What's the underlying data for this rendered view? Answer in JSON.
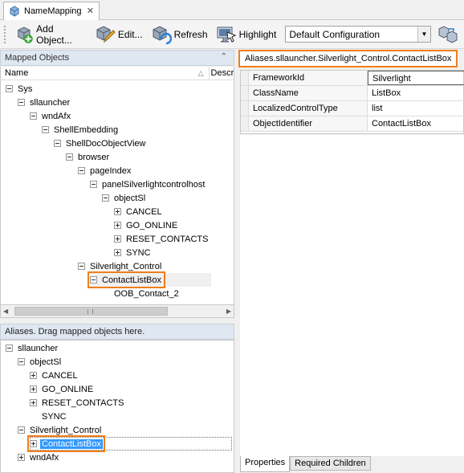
{
  "tab": {
    "title": "NameMapping",
    "close_glyph": "✕"
  },
  "toolbar": {
    "add_object_label": "Add Object...",
    "edit_label": "Edit...",
    "refresh_label": "Refresh",
    "highlight_label": "Highlight",
    "configuration_value": "Default Configuration"
  },
  "mapped_objects": {
    "title": "Mapped Objects",
    "columns": [
      "Name",
      "Descr"
    ],
    "tree": [
      {
        "label": "Sys",
        "level": 0,
        "toggle": "minus"
      },
      {
        "label": "sllauncher",
        "level": 1,
        "toggle": "minus"
      },
      {
        "label": "wndAfx",
        "level": 2,
        "toggle": "minus"
      },
      {
        "label": "ShellEmbedding",
        "level": 3,
        "toggle": "minus"
      },
      {
        "label": "ShellDocObjectView",
        "level": 4,
        "toggle": "minus"
      },
      {
        "label": "browser",
        "level": 5,
        "toggle": "minus"
      },
      {
        "label": "pageIndex",
        "level": 6,
        "toggle": "minus"
      },
      {
        "label": "panelSilverlightcontrolhost",
        "level": 7,
        "toggle": "minus"
      },
      {
        "label": "objectSl",
        "level": 8,
        "toggle": "minus"
      },
      {
        "label": "CANCEL",
        "level": 9,
        "toggle": "plus"
      },
      {
        "label": "GO_ONLINE",
        "level": 9,
        "toggle": "plus"
      },
      {
        "label": "RESET_CONTACTS",
        "level": 9,
        "toggle": "plus"
      },
      {
        "label": "SYNC",
        "level": 9,
        "toggle": "plus"
      },
      {
        "label": "Silverlight_Control",
        "level": 6,
        "toggle": "minus"
      },
      {
        "label": "ContactListBox",
        "level": 7,
        "toggle": "minus",
        "selected": true,
        "highlighted": true
      },
      {
        "label": "OOB_Contact_2",
        "level": 8,
        "toggle": "none"
      }
    ]
  },
  "aliases": {
    "title": "Aliases. Drag mapped objects here.",
    "tree": [
      {
        "label": "sllauncher",
        "level": 0,
        "toggle": "minus"
      },
      {
        "label": "objectSl",
        "level": 1,
        "toggle": "minus"
      },
      {
        "label": "CANCEL",
        "level": 2,
        "toggle": "plus"
      },
      {
        "label": "GO_ONLINE",
        "level": 2,
        "toggle": "plus"
      },
      {
        "label": "RESET_CONTACTS",
        "level": 2,
        "toggle": "plus"
      },
      {
        "label": "SYNC",
        "level": 2,
        "toggle": "none"
      },
      {
        "label": "Silverlight_Control",
        "level": 1,
        "toggle": "minus"
      },
      {
        "label": "ContactListBox",
        "level": 2,
        "toggle": "plus",
        "selected": true,
        "highlighted": true
      },
      {
        "label": "wndAfx",
        "level": 1,
        "toggle": "plus"
      }
    ]
  },
  "details": {
    "alias_path": "Aliases.sllauncher.Silverlight_Control.ContactListBox",
    "properties": [
      {
        "name": "FrameworkId",
        "value": "Silverlight"
      },
      {
        "name": "ClassName",
        "value": "ListBox"
      },
      {
        "name": "LocalizedControlType",
        "value": "list"
      },
      {
        "name": "ObjectIdentifier",
        "value": "ContactListBox"
      }
    ],
    "tabs": [
      "Properties",
      "Required Children"
    ]
  },
  "colors": {
    "highlight_border": "#f07d1a",
    "selection_blue": "#3399ff",
    "header_bg": "#dfe7f1"
  },
  "icons": [
    "namemapping-icon",
    "add-object-icon",
    "edit-icon",
    "refresh-icon",
    "highlight-icon",
    "dropdown-icon",
    "layout-icon",
    "collapse-icon"
  ]
}
